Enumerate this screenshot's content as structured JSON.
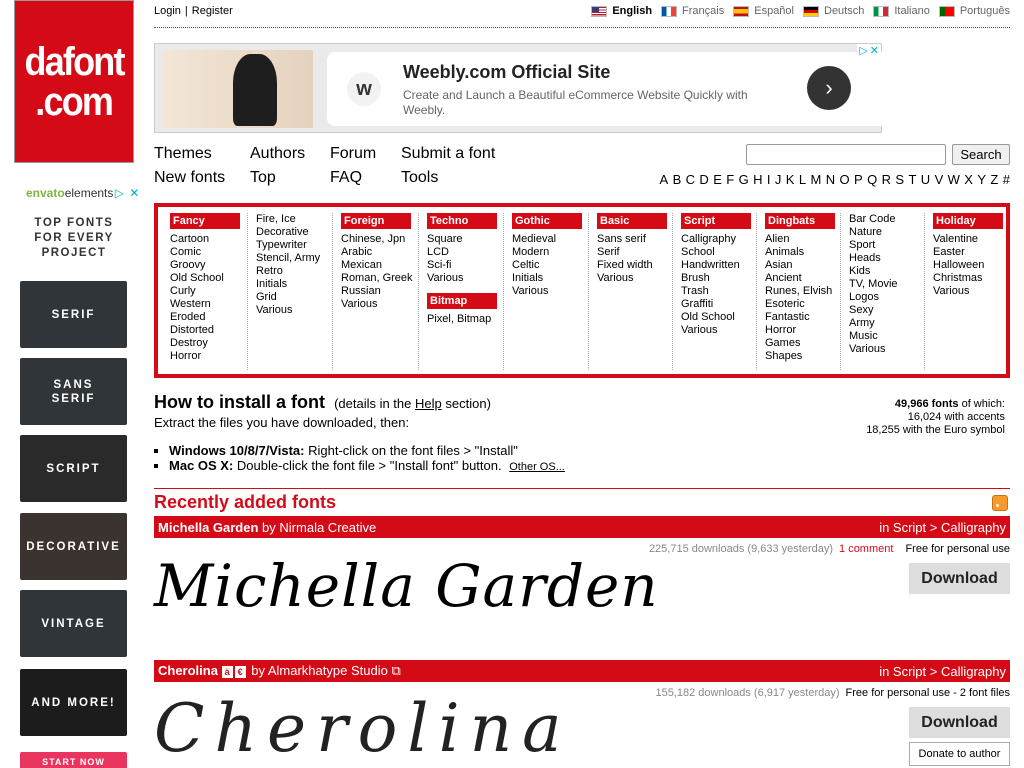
{
  "logo": {
    "line1": "dafont",
    "line2": ".com"
  },
  "auth": {
    "login": "Login",
    "separator": "|",
    "register": "Register"
  },
  "languages": [
    {
      "label": "English",
      "flag": "us",
      "active": true
    },
    {
      "label": "Français",
      "flag": "fr",
      "active": false
    },
    {
      "label": "Español",
      "flag": "es",
      "active": false
    },
    {
      "label": "Deutsch",
      "flag": "de",
      "active": false
    },
    {
      "label": "Italiano",
      "flag": "it",
      "active": false
    },
    {
      "label": "Português",
      "flag": "pt",
      "active": false
    }
  ],
  "ad_banner": {
    "title": "Weebly.com Official Site",
    "description": "Create and Launch a Beautiful eCommerce Website Quickly with Weebly.",
    "logo_letter": "w",
    "arrow": "›"
  },
  "envato_ad": {
    "brand_prefix": "envato",
    "brand_suffix": "elements",
    "tagline": [
      "TOP FONTS",
      "FOR EVERY",
      "PROJECT"
    ],
    "tiles": [
      "SERIF",
      "SANS SERIF",
      "SCRIPT",
      "DECORATIVE",
      "VINTAGE",
      "AND MORE!"
    ],
    "cta": "START NOW"
  },
  "nav": {
    "themes": "Themes",
    "authors": "Authors",
    "forum": "Forum",
    "submit": "Submit a font",
    "new_fonts": "New fonts",
    "top": "Top",
    "faq": "FAQ",
    "tools": "Tools"
  },
  "search": {
    "button": "Search",
    "value": ""
  },
  "alphabet": [
    "A",
    "B",
    "C",
    "D",
    "E",
    "F",
    "G",
    "H",
    "I",
    "J",
    "K",
    "L",
    "M",
    "N",
    "O",
    "P",
    "Q",
    "R",
    "S",
    "T",
    "U",
    "V",
    "W",
    "X",
    "Y",
    "Z",
    "#"
  ],
  "categories": [
    {
      "head": "Fancy",
      "items": [
        "Cartoon",
        "Comic",
        "Groovy",
        "Old School",
        "Curly",
        "Western",
        "Eroded",
        "Distorted",
        "Destroy",
        "Horror"
      ]
    },
    {
      "head": "",
      "items": [
        "Fire, Ice",
        "Decorative",
        "Typewriter",
        "Stencil, Army",
        "Retro",
        "Initials",
        "Grid",
        "Various"
      ]
    },
    {
      "head": "Foreign look",
      "items": [
        "Chinese, Jpn",
        "Arabic",
        "Mexican",
        "Roman, Greek",
        "Russian",
        "Various"
      ]
    },
    {
      "head": "Techno",
      "items": [
        "Square",
        "LCD",
        "Sci-fi",
        "Various"
      ],
      "head2": "Bitmap",
      "items2": [
        "Pixel, Bitmap"
      ]
    },
    {
      "head": "Gothic",
      "items": [
        "Medieval",
        "Modern",
        "Celtic",
        "Initials",
        "Various"
      ]
    },
    {
      "head": "Basic",
      "items": [
        "Sans serif",
        "Serif",
        "Fixed width",
        "Various"
      ]
    },
    {
      "head": "Script",
      "items": [
        "Calligraphy",
        "School",
        "Handwritten",
        "Brush",
        "Trash",
        "Graffiti",
        "Old School",
        "Various"
      ]
    },
    {
      "head": "Dingbats",
      "items": [
        "Alien",
        "Animals",
        "Asian",
        "Ancient",
        "Runes, Elvish",
        "Esoteric",
        "Fantastic",
        "Horror",
        "Games",
        "Shapes"
      ]
    },
    {
      "head": "",
      "items": [
        "Bar Code",
        "Nature",
        "Sport",
        "Heads",
        "Kids",
        "TV, Movie",
        "Logos",
        "Sexy",
        "Army",
        "Music",
        "Various"
      ]
    },
    {
      "head": "Holiday",
      "items": [
        "Valentine",
        "Easter",
        "Halloween",
        "Christmas",
        "Various"
      ]
    }
  ],
  "install": {
    "title": "How to install a font",
    "details_prefix": "(details in the",
    "details_link": "Help",
    "details_suffix": "section)",
    "extract": "Extract the files you have downloaded, then:",
    "windows_label": "Windows 10/8/7/Vista:",
    "windows_text": "Right-click on the font files > \"Install\"",
    "mac_label": "Mac OS X:",
    "mac_text": "Double-click the font file > \"Install font\" button.",
    "other_os": "Other OS..."
  },
  "stats": {
    "total": "49,966 fonts",
    "total_suffix": "of which:",
    "accents": "16,024 with accents",
    "euro": "18,255 with the Euro symbol"
  },
  "recent_title": "Recently added fonts",
  "fonts": [
    {
      "name": "Michella Garden",
      "by": "by",
      "author": "Nirmala Creative",
      "category": "in Script > Calligraphy",
      "downloads": "225,715 downloads (9,633 yesterday)",
      "comments": "1 comment",
      "license": "Free for personal use",
      "download_label": "Download",
      "preview": "Michella Garden"
    },
    {
      "name": "Cherolina",
      "badges": [
        "ä",
        "€"
      ],
      "by": "by",
      "author": "Almarkhatype Studio",
      "category": "in Script > Calligraphy",
      "downloads": "155,182 downloads (6,917 yesterday)",
      "license": "Free for personal use - 2 font files",
      "download_label": "Download",
      "donate_label": "Donate to author",
      "preview": "Cherolina"
    }
  ]
}
